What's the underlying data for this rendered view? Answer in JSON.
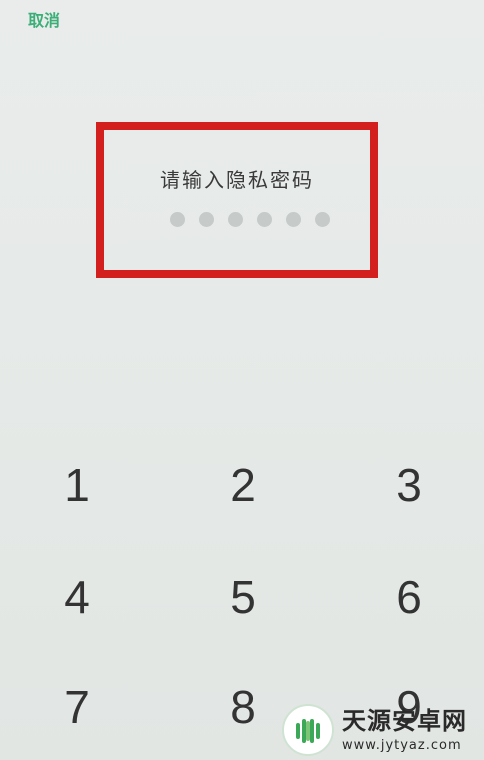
{
  "header": {
    "cancel_label": "取消"
  },
  "password_panel": {
    "prompt": "请输入隐私密码",
    "dot_count": 6,
    "entered_digits": 0
  },
  "keypad": {
    "keys": [
      "1",
      "2",
      "3",
      "4",
      "5",
      "6",
      "7",
      "8",
      "9"
    ]
  },
  "watermark": {
    "title": "天源安卓网",
    "url": "www.jytyaz.com"
  },
  "colors": {
    "accent_green": "#3dae77",
    "highlight_red": "#d3201f",
    "dot_gray": "#c6cac8",
    "background": "#e8ebe9"
  }
}
